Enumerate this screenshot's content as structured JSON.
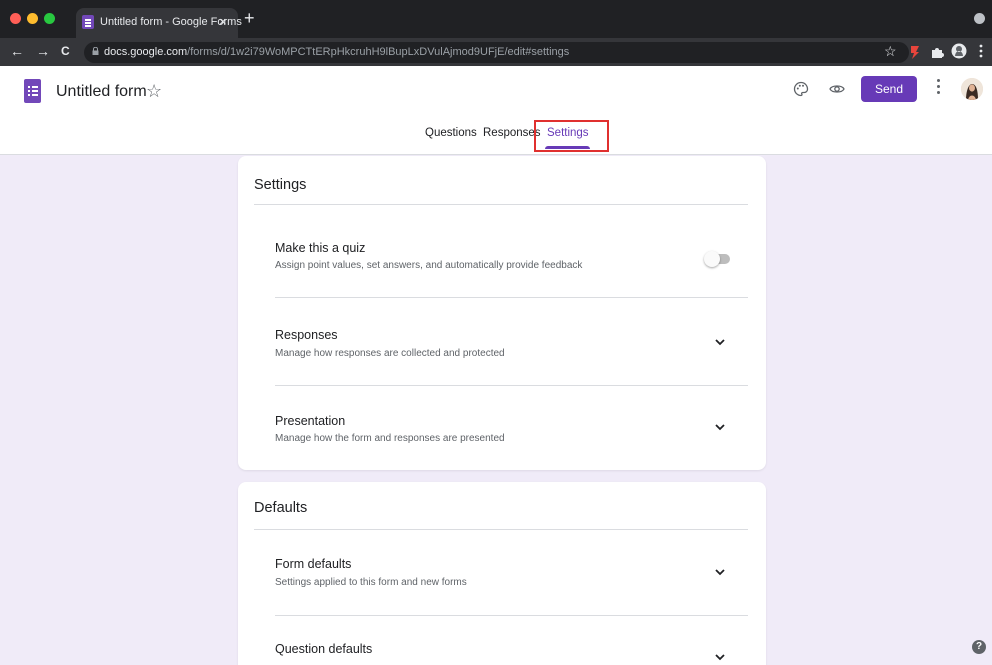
{
  "browser": {
    "tab_title": "Untitled form - Google Forms",
    "tab_close": "×",
    "new_tab": "+",
    "url_host": "docs.google.com",
    "url_path": "/forms/d/1w2i79WoMPCTtERpHkcruhH9lBupLxDVulAjmod9UFjE/edit#settings",
    "back": "←",
    "forward": "→",
    "reload": "C",
    "bookmark_star": "☆",
    "traffic_lights": [
      "#ff5f57",
      "#febc2e",
      "#28c840"
    ]
  },
  "header": {
    "form_title": "Untitled form",
    "star": "☆",
    "send_label": "Send",
    "accent": "#673ab7"
  },
  "tabs": {
    "questions": "Questions",
    "responses": "Responses",
    "settings": "Settings",
    "active": "settings"
  },
  "settings_card": {
    "title": "Settings",
    "items": [
      {
        "title": "Make this a quiz",
        "desc": "Assign point values, set answers, and automatically provide feedback",
        "control": "toggle",
        "checked": false
      },
      {
        "title": "Responses",
        "desc": "Manage how responses are collected and protected",
        "control": "chevron-down-icon"
      },
      {
        "title": "Presentation",
        "desc": "Manage how the form and responses are presented",
        "control": "chevron-down-icon"
      }
    ]
  },
  "defaults_card": {
    "title": "Defaults",
    "items": [
      {
        "title": "Form defaults",
        "desc": "Settings applied to this form and new forms",
        "control": "chevron-down-icon"
      },
      {
        "title": "Question defaults",
        "control": "chevron-down-icon"
      }
    ]
  },
  "help": "?"
}
